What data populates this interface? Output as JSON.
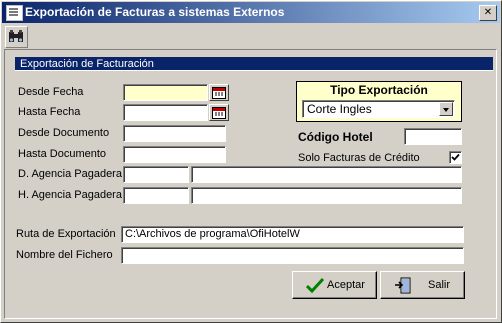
{
  "window": {
    "title": "Exportación de Facturas a sistemas Externos",
    "close_glyph": "✕"
  },
  "toolbar": {
    "search_icon": "binoculars-icon"
  },
  "section": {
    "title": "Exportación de Facturación"
  },
  "labels": {
    "desde_fecha": "Desde Fecha",
    "hasta_fecha": "Hasta Fecha",
    "desde_documento": "Desde Documento",
    "hasta_documento": "Hasta Documento",
    "d_agencia": "D. Agencia Pagadera",
    "h_agencia": "H. Agencia Pagadera",
    "ruta": "Ruta de Exportación",
    "nombre": "Nombre del Fichero",
    "codigo_hotel": "Código Hotel",
    "solo_credito": "Solo Facturas de Crédito"
  },
  "fields": {
    "desde_fecha": "",
    "hasta_fecha": "",
    "desde_documento": "",
    "hasta_documento": "",
    "d_agencia_code": "",
    "d_agencia_name": "",
    "h_agencia_code": "",
    "h_agencia_name": "",
    "ruta": "C:\\Archivos de programa\\OfiHotelW",
    "nombre": "",
    "codigo_hotel": ""
  },
  "tipo_exportacion": {
    "title": "Tipo Exportación",
    "selected": "Corte Ingles"
  },
  "solo_credito_checked": true,
  "buttons": {
    "aceptar": "Aceptar",
    "salir": "Salir"
  },
  "colors": {
    "title_start": "#0a246a",
    "title_end": "#a6caf0",
    "section_bar": "#0a246a",
    "highlight_field": "#ffffcc"
  }
}
